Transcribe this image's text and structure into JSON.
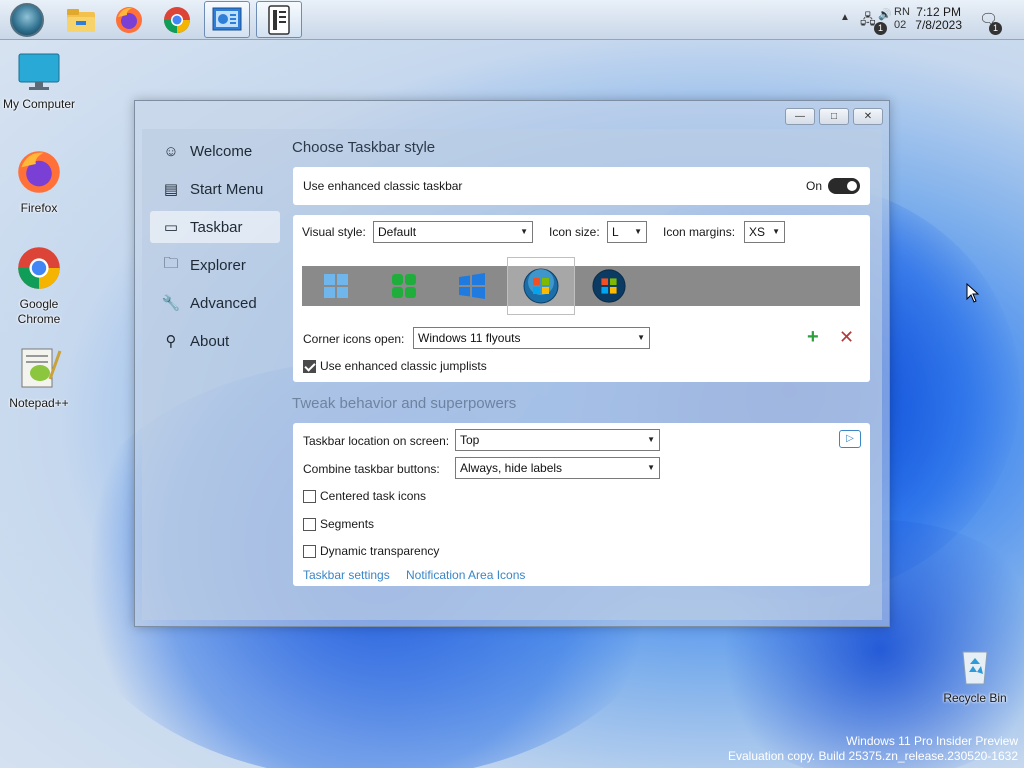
{
  "taskbar": {
    "apps": [
      {
        "name": "File Explorer"
      },
      {
        "name": "Firefox"
      },
      {
        "name": "Google Chrome"
      },
      {
        "name": "Control Panel"
      },
      {
        "name": "Settings"
      }
    ],
    "clock": {
      "time": "7:12 PM",
      "date": "7/8/2023"
    },
    "tray_partial_text": {
      "line1": "RN",
      "line2": "02"
    },
    "badges": {
      "network": "1",
      "notifications": "1"
    }
  },
  "desktop": {
    "icons": [
      {
        "label": "My Computer"
      },
      {
        "label": "Firefox"
      },
      {
        "label": "Google Chrome"
      },
      {
        "label": "Notepad++"
      },
      {
        "label": "Recycle Bin"
      }
    ]
  },
  "window": {
    "controls": {
      "minimize": "—",
      "maximize": "□",
      "close": "✕"
    },
    "nav": [
      {
        "label": "Welcome",
        "icon": "smiley-icon"
      },
      {
        "label": "Start Menu",
        "icon": "start-menu-icon"
      },
      {
        "label": "Taskbar",
        "icon": "taskbar-icon"
      },
      {
        "label": "Explorer",
        "icon": "folder-icon"
      },
      {
        "label": "Advanced",
        "icon": "wrench-icon"
      },
      {
        "label": "About",
        "icon": "about-icon"
      }
    ],
    "selected_nav": "Taskbar",
    "style_section": {
      "title": "Choose Taskbar style",
      "enhanced_taskbar_label": "Use enhanced classic taskbar",
      "toggle_state": "On",
      "visual_style_label": "Visual style:",
      "visual_style_value": "Default",
      "icon_size_label": "Icon size:",
      "icon_size_value": "L",
      "icon_margins_label": "Icon margins:",
      "icon_margins_value": "XS",
      "start_button_styles": [
        "Windows 11",
        "Windows 10 green",
        "Windows 10 blue",
        "Windows 7 orb",
        "Windows Vista orb"
      ],
      "selected_style": "Windows 7 orb",
      "corner_icons_label": "Corner icons open:",
      "corner_icons_value": "Windows 11 flyouts",
      "jumplists_label": "Use enhanced classic jumplists",
      "jumplists_checked": true
    },
    "behavior_section": {
      "title": "Tweak behavior and superpowers",
      "location_label": "Taskbar location on screen:",
      "location_value": "Top",
      "combine_label": "Combine taskbar buttons:",
      "combine_value": "Always, hide labels",
      "centered_label": "Centered task icons",
      "segments_label": "Segments",
      "transparency_label": "Dynamic transparency",
      "link_taskbar_settings": "Taskbar settings",
      "link_notification_icons": "Notification Area Icons"
    }
  },
  "watermark": {
    "line1": "Windows 11 Pro Insider Preview",
    "line2": "Evaluation copy. Build 25375.zn_release.230520-1632"
  },
  "colors": {
    "accent_link": "#3a86c8",
    "add_icon": "#2e9e3e",
    "remove_icon": "#b23a3a"
  }
}
